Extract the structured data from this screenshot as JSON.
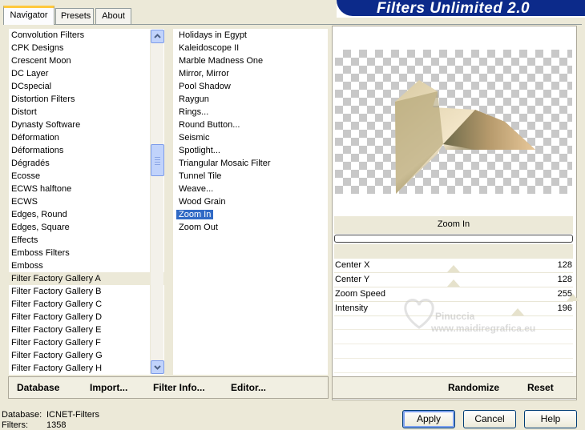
{
  "tabs": [
    {
      "label": "Navigator"
    },
    {
      "label": "Presets"
    },
    {
      "label": "About"
    }
  ],
  "banner_title": "Filters Unlimited 2.0",
  "categories": [
    "Convolution Filters",
    "CPK Designs",
    "Crescent Moon",
    "DC Layer",
    "DCspecial",
    "Distortion Filters",
    "Distort",
    "Dynasty Software",
    "Déformation",
    "Déformations",
    "Dégradés",
    "Ecosse",
    "ECWS halftone",
    "ECWS",
    "Edges, Round",
    "Edges, Square",
    "Effects",
    "Emboss Filters",
    "Emboss",
    "Filter Factory Gallery A",
    "Filter Factory Gallery B",
    "Filter Factory Gallery C",
    "Filter Factory Gallery D",
    "Filter Factory Gallery E",
    "Filter Factory Gallery F",
    "Filter Factory Gallery G",
    "Filter Factory Gallery H"
  ],
  "selected_category": "Filter Factory Gallery A",
  "filters": [
    "Holidays in Egypt",
    "Kaleidoscope II",
    "Marble Madness One",
    "Mirror, Mirror",
    "Pool Shadow",
    "Raygun",
    "Rings...",
    "Round Button...",
    "Seismic",
    "Spotlight...",
    "Triangular Mosaic Filter",
    "Tunnel Tile",
    "Weave...",
    "Wood Grain",
    "Zoom In",
    "Zoom Out"
  ],
  "selected_filter": "Zoom In",
  "preview_label": "Zoom In",
  "params": [
    {
      "label": "Center X",
      "value": "128",
      "level": 0.5
    },
    {
      "label": "Center Y",
      "value": "128",
      "level": 0.5
    },
    {
      "label": "Zoom Speed",
      "value": "255",
      "level": 1.0
    },
    {
      "label": "Intensity",
      "value": "196",
      "level": 0.77
    }
  ],
  "left_buttons": {
    "database": "Database",
    "import": "Import...",
    "filter_info": "Filter Info...",
    "editor": "Editor..."
  },
  "right_buttons": {
    "randomize": "Randomize",
    "reset": "Reset"
  },
  "status": {
    "database_label": "Database:",
    "database_value": "ICNET-Filters",
    "filters_label": "Filters:",
    "filters_value": "1358"
  },
  "dialog_buttons": {
    "apply": "Apply",
    "cancel": "Cancel",
    "help": "Help"
  },
  "watermark": {
    "name": "Pinuccia",
    "site": "www.maidiregrafica.eu"
  }
}
